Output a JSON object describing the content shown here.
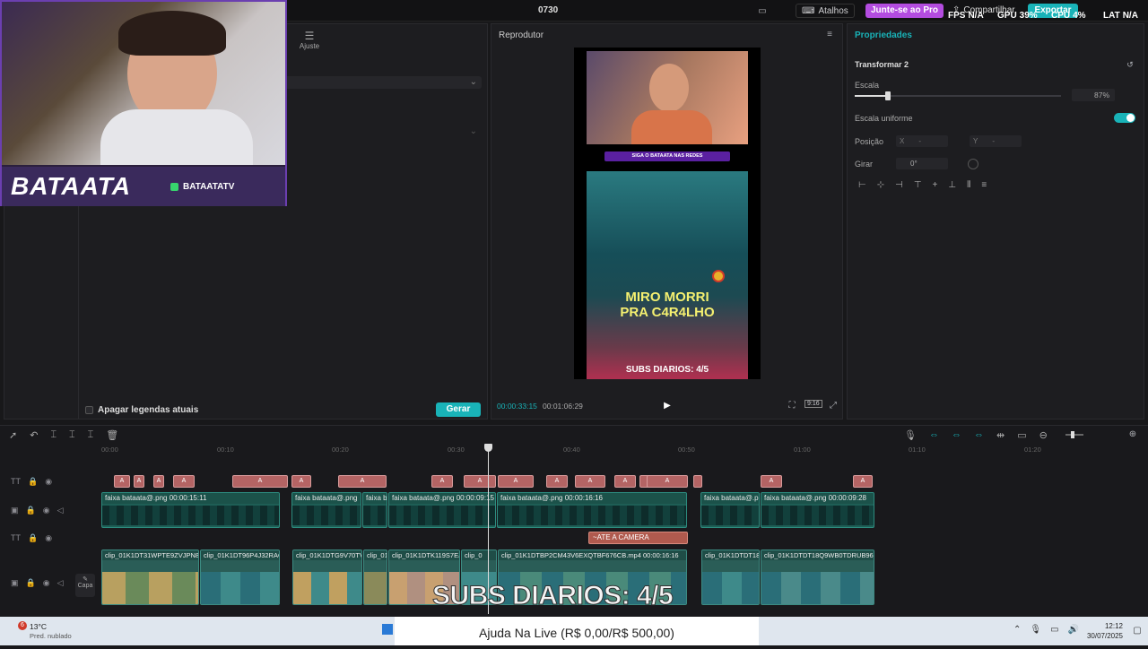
{
  "topbar": {
    "title": "0730",
    "atalhos": "Atalhos",
    "pro": "Junte-se ao Pro",
    "share": "Compartilhar",
    "export": "Exportar",
    "fps_label": "FPS",
    "fps": "N/A",
    "gpu_label": "GPU",
    "gpu": "39%",
    "cpu_label": "CPU",
    "cpu": "4%",
    "lat_label": "LAT",
    "lat": "N/A"
  },
  "left_panel": {
    "ajuste_label": "Ajuste",
    "checkbox_label": "Apagar legendas atuais",
    "gerar_label": "Gerar"
  },
  "webcam_overlay": {
    "brand": "BATAATA",
    "handle": "BATAATATV"
  },
  "player": {
    "title": "Reprodutor",
    "current_time": "00:00:33:15",
    "total_time": "00:01:06:29",
    "preview_banner": "SIGA O BATAATA NAS REDES",
    "caption_line1": "MIRO MORRI",
    "caption_line2": "PRA C4R4LHO",
    "subs_text": "SUBS DIARIOS: 4/5",
    "ratio_label": "9:16"
  },
  "properties": {
    "title": "Propriedades",
    "section": "Transformar 2",
    "escala_label": "Escala",
    "escala_value": "87%",
    "escala_level": 0.16,
    "uniform_label": "Escala uniforme",
    "posicao_label": "Posição",
    "x_label": "X",
    "x_value": "-",
    "y_label": "Y",
    "y_value": "-",
    "girar_label": "Girar",
    "girar_value": "0°"
  },
  "timeline": {
    "ruler": [
      "00:00",
      "00:10",
      "00:20",
      "00:30",
      "00:40",
      "00:50",
      "01:00",
      "01:10",
      "01:20"
    ],
    "capa_label": "Capa",
    "overlay_segments": [
      {
        "label": "faixa bataata@.png  00:00:15:11"
      },
      {
        "label": "faixa bataata@.png"
      },
      {
        "label": "faixa b"
      },
      {
        "label": "faixa bataata@.png  00:00:09:15"
      },
      {
        "label": "faixa bataata@.png  00:00:16:16"
      },
      {
        "label": "faixa bataata@.p"
      },
      {
        "label": "faixa bataata@.png  00:00:09:28"
      }
    ],
    "text_clip": "~ATE A CAMERA",
    "clip_segments": [
      {
        "label": "clip_01K1DT31WPTE9ZVJPN8"
      },
      {
        "label": "clip_01K1DT96P4J32RAC"
      },
      {
        "label": "clip_01K1DTG9V70TV"
      },
      {
        "label": "clip_01"
      },
      {
        "label": "clip_01K1DTK119S7EJ"
      },
      {
        "label": "clip_0"
      },
      {
        "label": "clip_01K1DTBP2CM43V6EXQTBF676CB.mp4  00:00:16:16"
      },
      {
        "label": "clip_01K1DTDT18"
      },
      {
        "label": "clip_01K1DTDT18Q9WB0TDRUB96Q"
      }
    ]
  },
  "overlay_subs": "SUBS DIARIOS: 4/5",
  "donation_bar": "Ajuda Na Live (R$ 0,00/R$ 500,00)",
  "taskbar": {
    "badge": "6",
    "temp": "13°C",
    "weather": "Pred. nublado",
    "time": "12:12",
    "date": "30/07/2025"
  },
  "colors": {
    "accent": "#19b3b8",
    "pro": "#b34ce0"
  }
}
